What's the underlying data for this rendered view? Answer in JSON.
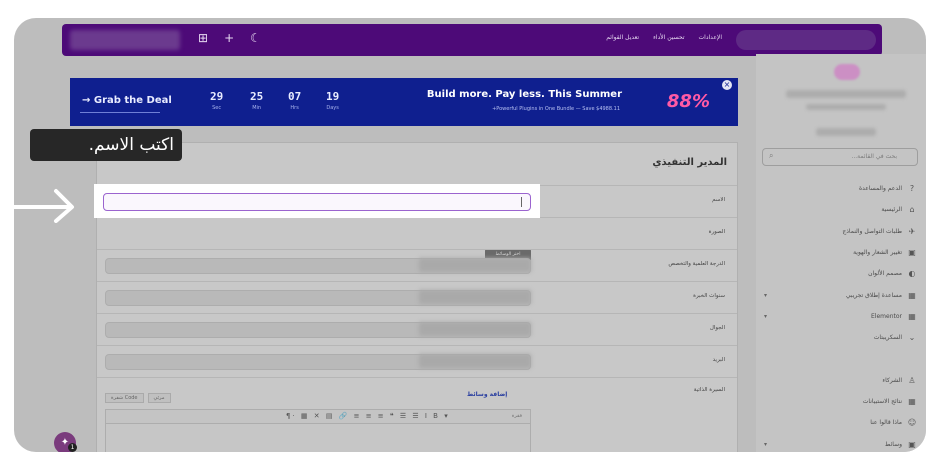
{
  "tooltip": {
    "text": "اكتب الاسم."
  },
  "topbar": {
    "icons": [
      "⊞",
      "+",
      "☾"
    ],
    "menu": [
      "الإعدادات",
      "تحسين الأداء",
      "تعديل القوائم"
    ]
  },
  "banner": {
    "deal_label": "→ Grab the Deal",
    "countdown": [
      {
        "value": "29",
        "unit": "Sec"
      },
      {
        "value": "25",
        "unit": "Min"
      },
      {
        "value": "07",
        "unit": "Hrs"
      },
      {
        "value": "19",
        "unit": "Days"
      }
    ],
    "title": "Build more. Pay less. This Summer",
    "subtitle": "+Powerful Plugins in One Bundle — Save $4988.11",
    "badge": "88%",
    "close": "×"
  },
  "sidebar": {
    "search_placeholder": "بحث في القائمة...",
    "items": [
      {
        "label": "الدعم والمساعدة",
        "icon": "?"
      },
      {
        "label": "الرئيسية",
        "icon": "⌂"
      },
      {
        "label": "طلبات التواصل والنماذج",
        "icon": "✈"
      },
      {
        "label": "تغيير الشعار والهوية",
        "icon": "▣"
      },
      {
        "label": "مصمم الألوان",
        "icon": "◐"
      },
      {
        "label": "مساعدة إطلاق تجريبي",
        "icon": "▦",
        "chevron": "▾"
      },
      {
        "label": "Elementor",
        "icon": "▦",
        "chevron": "▾"
      },
      {
        "label": "السكريبتات",
        "icon": "⌄"
      },
      {
        "label": "",
        "icon": ""
      },
      {
        "label": "الشركاء",
        "icon": "♙"
      },
      {
        "label": "نتائج الاستبيانات",
        "icon": "▦"
      },
      {
        "label": "ماذا قالوا عنا",
        "icon": "☺"
      },
      {
        "label": "وسائط",
        "icon": "▣",
        "chevron": "▾"
      }
    ]
  },
  "card": {
    "title": "المدير التنفيذي",
    "fields": [
      {
        "label": "الاسم"
      },
      {
        "label": "الصورة"
      },
      {
        "label": "الدرجة العلمية والتخصص"
      },
      {
        "label": "سنوات الخبرة"
      },
      {
        "label": "الجوال"
      },
      {
        "label": "البريد"
      },
      {
        "label": "السيرة الذاتية"
      }
    ],
    "media_button": "اختر الوسائط",
    "add_media": "إضافة وسائط",
    "editor_tabs": [
      "مرئي",
      "شفرة Code"
    ],
    "editor_tools": "¶· ▦ ✕ ▤ 🔗 ≡ ≡ ≡ ❝ ☰ ☰ I B ▾",
    "editor_format": "فقرة"
  },
  "help_badge": "1"
}
